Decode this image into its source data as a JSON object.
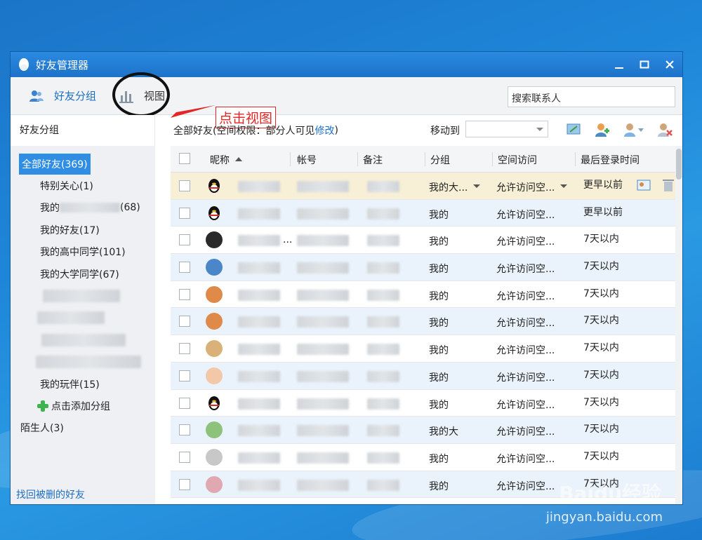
{
  "window": {
    "title": "好友管理器"
  },
  "toolbar": {
    "friend_groups_label": "好友分组",
    "view_label": "视图",
    "search_placeholder": "搜索联系人",
    "annotation": "点击视图"
  },
  "sidebar": {
    "header": "好友分组",
    "items": [
      {
        "label": "全部好友(369)",
        "selected": true
      },
      {
        "label": "特别关心(1)"
      },
      {
        "label": "我的",
        "suffix": "(68)",
        "blurred": true
      },
      {
        "label": "我的好友(17)"
      },
      {
        "label": "我的高中同学(101)"
      },
      {
        "label": "我的大学同学(67)"
      },
      {
        "label": "",
        "blurred": true
      },
      {
        "label": "",
        "blurred": true
      },
      {
        "label": "",
        "blurred": true
      },
      {
        "label": "",
        "blurred": true
      },
      {
        "label": "我的玩伴(15)"
      }
    ],
    "add_group": "点击添加分组",
    "strangers": "陌生人(3)",
    "footer_link": "找回被删的好友"
  },
  "main": {
    "header_prefix": "全部好友(空间权限：部分人可见",
    "header_link": "修改",
    "header_suffix": ")",
    "move_to_label": "移动到"
  },
  "grid": {
    "columns": [
      "昵称",
      "帐号",
      "备注",
      "分组",
      "空间访问",
      "最后登录时间"
    ],
    "rows": [
      {
        "nick": "",
        "group": "我的大...",
        "access": "允许访问空...",
        "last": "更早以前",
        "highlight": true,
        "avatar": "qq-penguin"
      },
      {
        "nick": "",
        "group": "我的",
        "access": "允许访问空...",
        "last": "更早以前",
        "avatar": "qq-penguin"
      },
      {
        "nick": "...",
        "group": "我的",
        "access": "允许访问空...",
        "last": "7天以内",
        "avatar": "dark"
      },
      {
        "nick": "",
        "group": "我的",
        "access": "允许访问空...",
        "last": "7天以内",
        "avatar": "blue"
      },
      {
        "nick": "",
        "group": "我的",
        "access": "允许访问空...",
        "last": "7天以内",
        "avatar": "orange"
      },
      {
        "nick": "",
        "group": "我的",
        "access": "允许访问空...",
        "last": "7天以内",
        "avatar": "orange"
      },
      {
        "nick": "",
        "group": "我的",
        "access": "允许访问空...",
        "last": "7天以内",
        "avatar": "tan"
      },
      {
        "nick": "",
        "group": "我的",
        "access": "允许访问空...",
        "last": "7天以内",
        "avatar": "peach"
      },
      {
        "nick": "",
        "group": "我的",
        "access": "允许访问空...",
        "last": "7天以内",
        "avatar": "qq-penguin"
      },
      {
        "nick": "",
        "group": "我的大",
        "access": "允许访问空...",
        "last": "7天以内",
        "avatar": "green"
      },
      {
        "nick": "",
        "group": "我的",
        "access": "允许访问空...",
        "last": "7天以内",
        "avatar": "gray"
      },
      {
        "nick": "",
        "group": "我的",
        "access": "允许访问空...",
        "last": "7天以内",
        "avatar": "pink"
      }
    ]
  },
  "watermark": {
    "brand": "Baidu经验",
    "url": "jingyan.baidu.com"
  }
}
